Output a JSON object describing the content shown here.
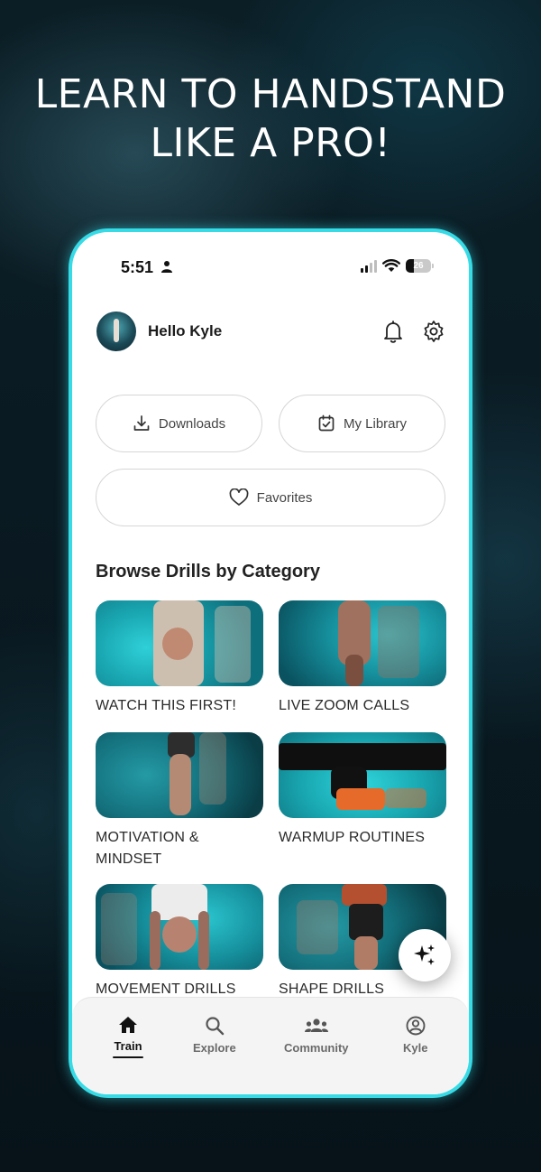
{
  "headline": {
    "line1": "LEARN TO HANDSTAND",
    "line2": "LIKE A PRO!"
  },
  "status_bar": {
    "time": "5:51",
    "battery": "26"
  },
  "header": {
    "greeting": "Hello Kyle"
  },
  "quick_actions": {
    "downloads": "Downloads",
    "my_library": "My Library",
    "favorites": "Favorites"
  },
  "section_title": "Browse Drills by Category",
  "categories": [
    {
      "label": "WATCH THIS FIRST!"
    },
    {
      "label": "LIVE ZOOM CALLS"
    },
    {
      "label": "MOTIVATION & MINDSET"
    },
    {
      "label": "WARMUP ROUTINES"
    },
    {
      "label": "MOVEMENT DRILLS"
    },
    {
      "label": "SHAPE DRILLS"
    }
  ],
  "tabbar": {
    "train": "Train",
    "explore": "Explore",
    "community": "Community",
    "kyle": "Kyle",
    "active": "Train"
  },
  "colors": {
    "accent": "#37dbe6",
    "teal": "#19a6b1"
  },
  "icons": [
    "person-icon",
    "signal-icon",
    "wifi-icon",
    "battery-icon",
    "bell-icon",
    "gear-icon",
    "download-icon",
    "calendar-check-icon",
    "heart-icon",
    "sparkle-icon",
    "home-icon",
    "search-icon",
    "community-icon",
    "profile-icon"
  ]
}
